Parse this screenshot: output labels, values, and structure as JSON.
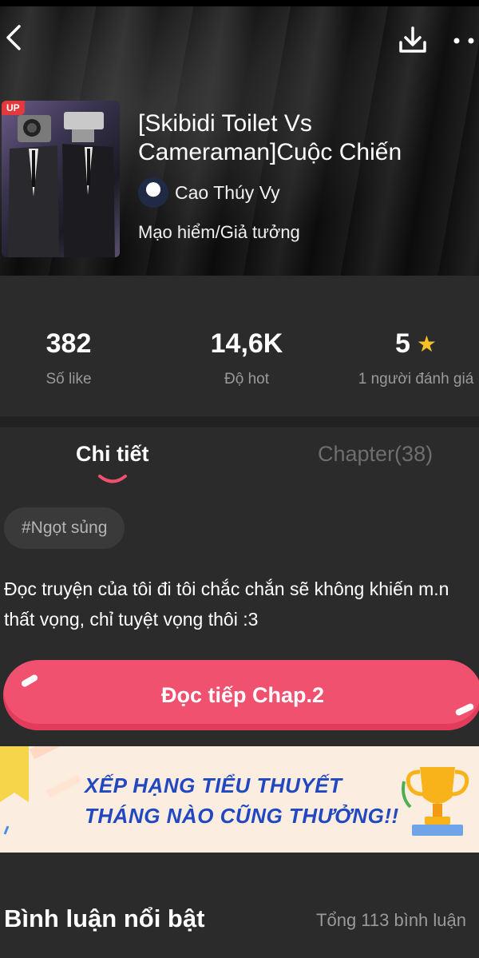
{
  "header": {
    "title": "[Skibidi Toilet Vs Cameraman]Cuộc Chiến",
    "author": "Cao Thúy Vy",
    "genre": "Mạo hiểm/Giả tưởng",
    "cover_badge": "UP",
    "icons": [
      "back-icon",
      "download-icon",
      "more-icon"
    ]
  },
  "stats": {
    "likes": {
      "value": "382",
      "label": "Số like"
    },
    "hot": {
      "value": "14,6K",
      "label": "Độ hot"
    },
    "rating": {
      "value": "5",
      "label": "1 người đánh giá",
      "icon": "star-icon"
    }
  },
  "tabs": {
    "detail": "Chi tiết",
    "chapter": "Chapter(38)"
  },
  "tag": "#Ngọt sủng",
  "description": "Đọc truyện của tôi đi tôi chắc chắn sẽ không khiến m.n thất vọng, chỉ tuyệt vọng thôi :3",
  "cta": "Đọc tiếp Chap.2",
  "banner": {
    "line1": "XẾP HẠNG TIỂU THUYẾT",
    "line2": "THÁNG NÀO CŨNG THƯỞNG!!"
  },
  "comments": {
    "title": "Bình luận nổi bật",
    "count": "Tổng 113 bình luận"
  },
  "colors": {
    "accent": "#f0516f",
    "star": "#f6c026",
    "banner_text": "#2148c0"
  }
}
